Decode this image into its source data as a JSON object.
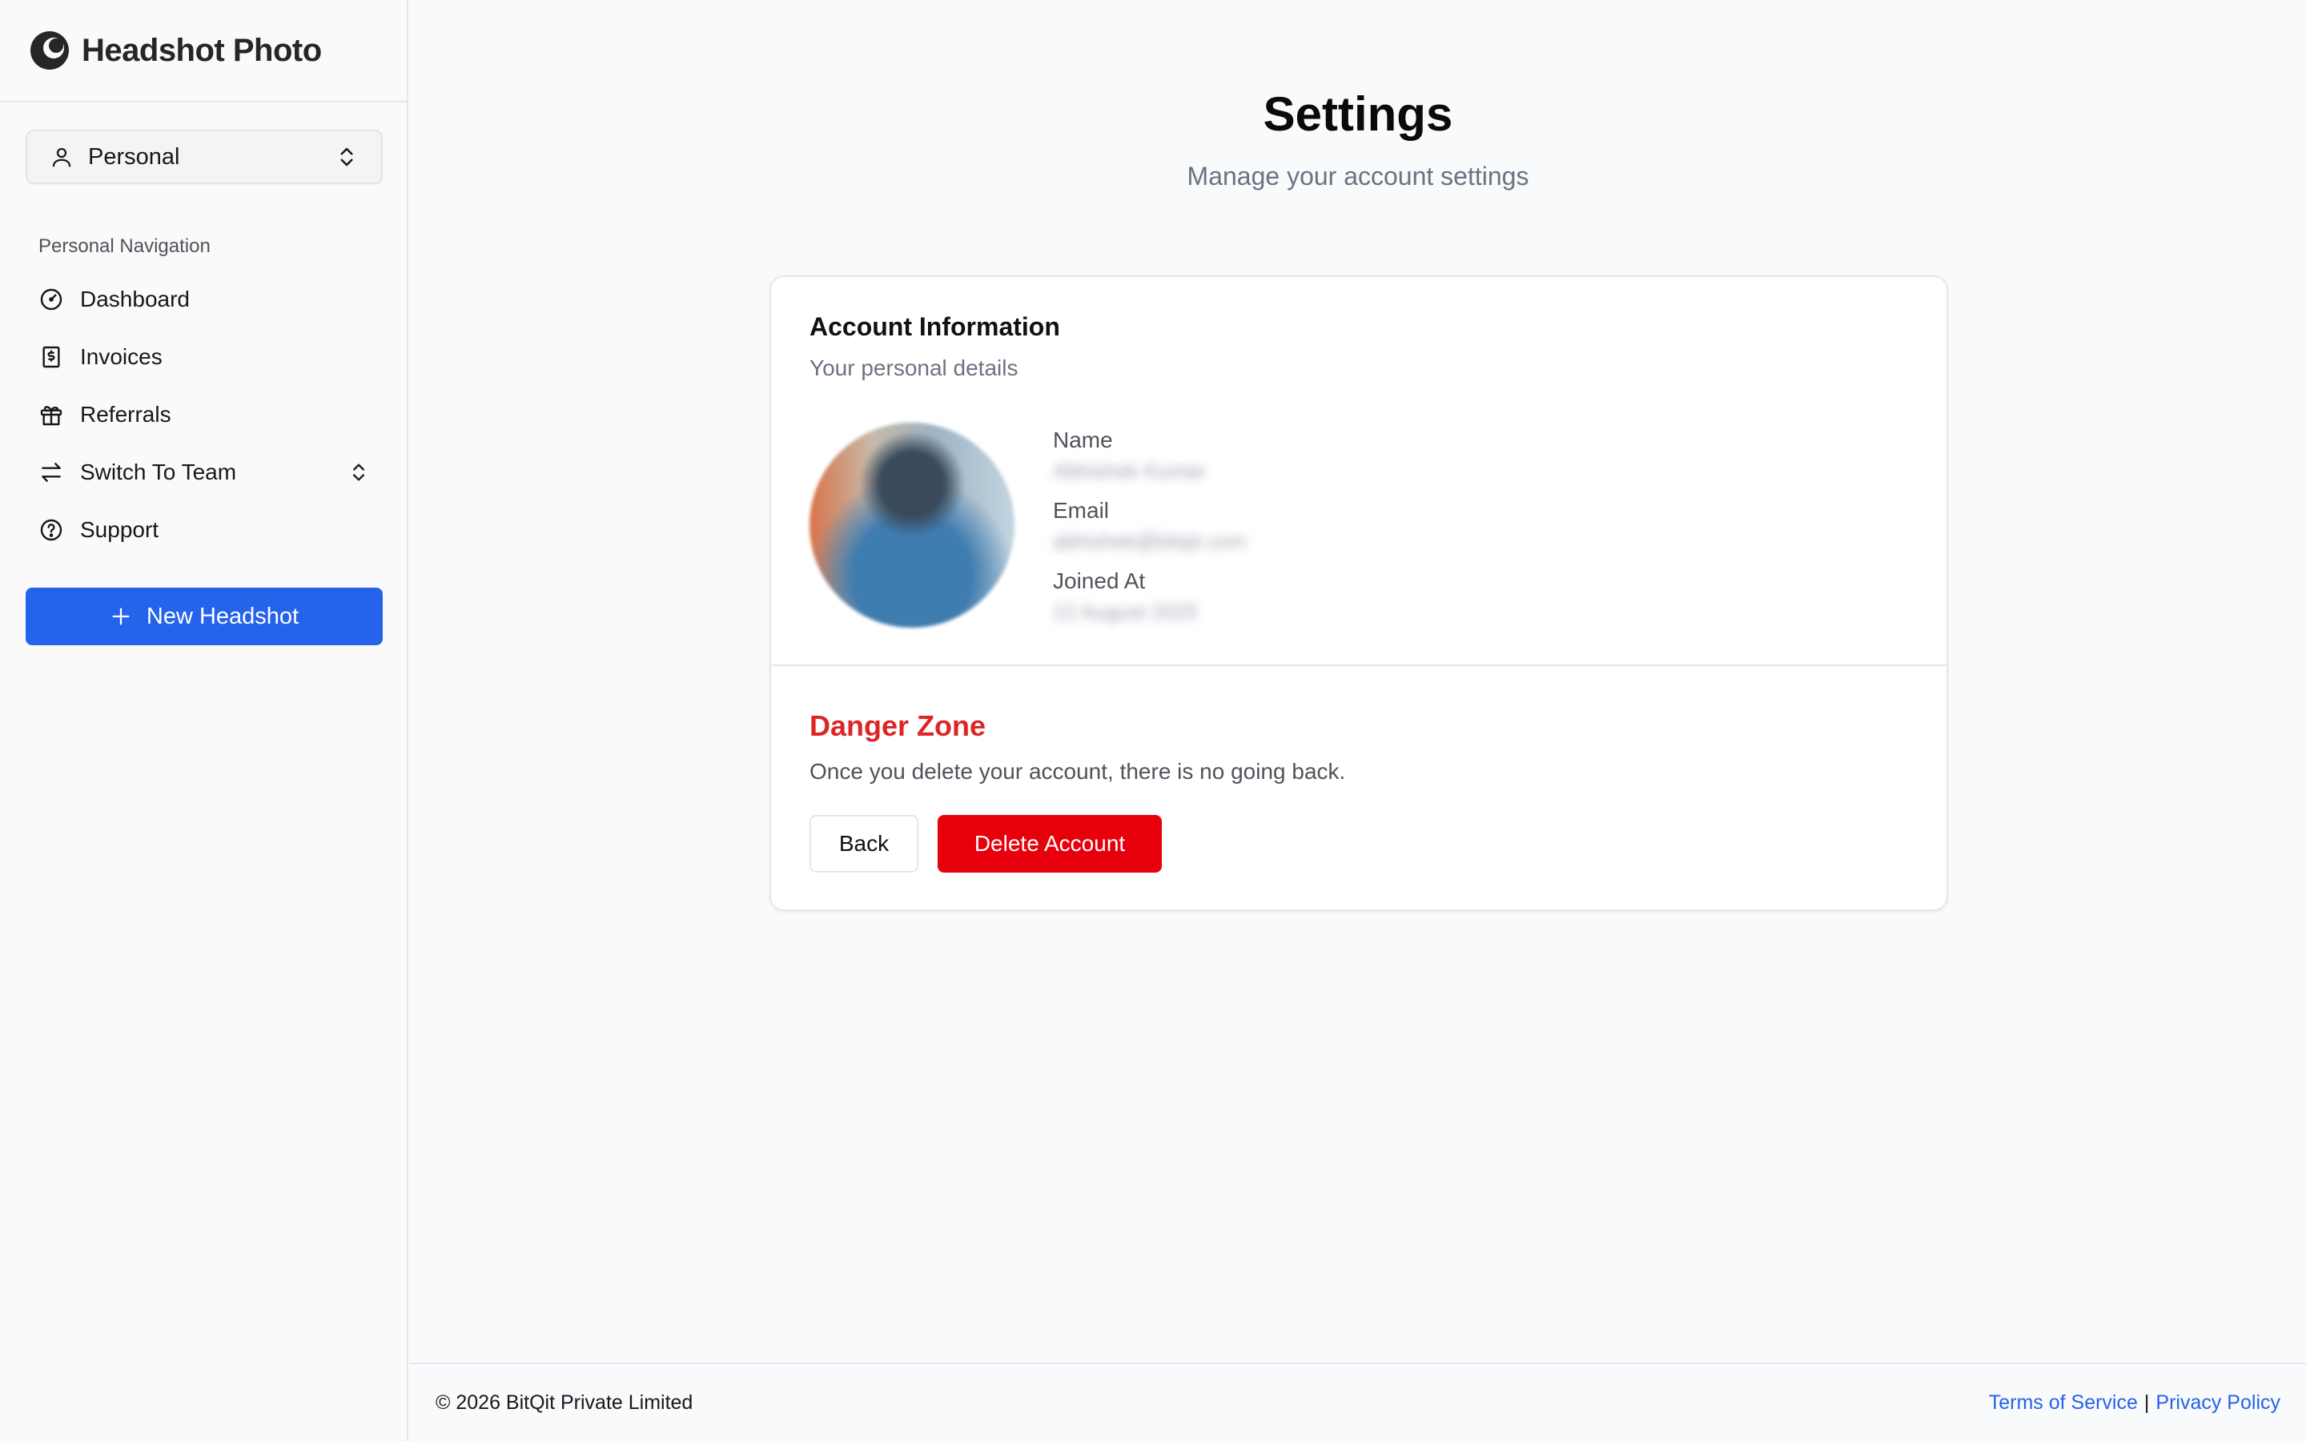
{
  "brand": {
    "name": "Headshot Photo",
    "logo_icon": "moon-logo-icon"
  },
  "account_switcher": {
    "label": "Personal",
    "icon": "user-icon"
  },
  "sidebar": {
    "heading": "Personal Navigation",
    "items": [
      {
        "label": "Dashboard",
        "icon": "gauge-icon"
      },
      {
        "label": "Invoices",
        "icon": "receipt-icon"
      },
      {
        "label": "Referrals",
        "icon": "gift-icon"
      },
      {
        "label": "Switch To Team",
        "icon": "arrows-swap-icon",
        "has_chevron": true
      },
      {
        "label": "Support",
        "icon": "help-circle-icon"
      }
    ],
    "new_button": "New Headshot"
  },
  "page": {
    "title": "Settings",
    "subtitle": "Manage your account settings"
  },
  "account_card": {
    "title": "Account Information",
    "description": "Your personal details",
    "fields": [
      {
        "label": "Name",
        "value": "Abhishek Kumar"
      },
      {
        "label": "Email",
        "value": "abhishek@bitqit.com"
      },
      {
        "label": "Joined At",
        "value": "12 August 2025"
      }
    ]
  },
  "danger_zone": {
    "title": "Danger Zone",
    "description": "Once you delete your account, there is no going back.",
    "back_label": "Back",
    "delete_label": "Delete Account"
  },
  "footer": {
    "copyright": "© 2026 BitQit Private Limited",
    "terms": "Terms of Service",
    "separator": "|",
    "privacy": "Privacy Policy"
  },
  "colors": {
    "primary": "#2563eb",
    "danger": "#e7000b",
    "danger_text": "#dc2626"
  }
}
